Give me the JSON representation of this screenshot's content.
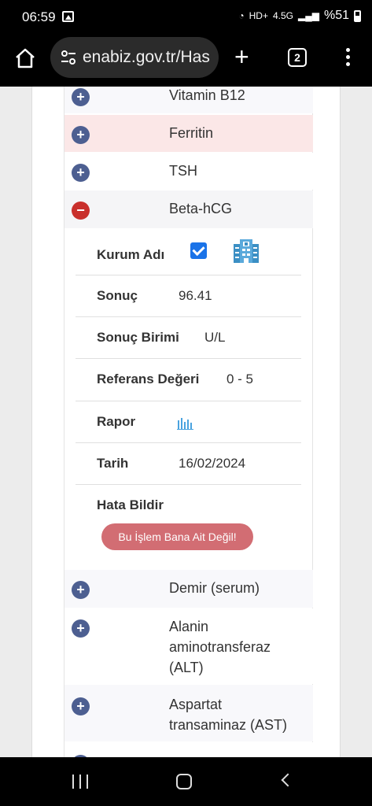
{
  "status_bar": {
    "time": "06:59",
    "network": "4.5G",
    "battery": "%51"
  },
  "browser": {
    "url": "enabiz.gov.tr/Has",
    "tab_count": "2"
  },
  "tests_above": [
    {
      "name": "Vitamin B12",
      "state": "collapsed"
    },
    {
      "name": "Ferritin",
      "state": "collapsed",
      "highlighted": true
    },
    {
      "name": "TSH",
      "state": "collapsed"
    }
  ],
  "expanded_test": {
    "name": "Beta-hCG",
    "state": "expanded",
    "fields": {
      "kurum_adi": {
        "label": "Kurum Adı",
        "checked": true
      },
      "sonuc": {
        "label": "Sonuç",
        "value": "96.41"
      },
      "sonuc_birimi": {
        "label": "Sonuç Birimi",
        "value": "U/L"
      },
      "referans_degeri": {
        "label": "Referans Değeri",
        "value": "0 - 5"
      },
      "rapor": {
        "label": "Rapor"
      },
      "tarih": {
        "label": "Tarih",
        "value": "16/02/2024"
      },
      "hata_bildir": {
        "label": "Hata Bildir",
        "button": "Bu İşlem Bana Ait Değil!"
      }
    }
  },
  "tests_below": [
    {
      "name": "Demir (serum)",
      "state": "collapsed"
    },
    {
      "name": "Alanin aminotransferaz (ALT)",
      "line1": "Alanin",
      "line2": "aminotransferaz",
      "line3": "(ALT)",
      "state": "collapsed"
    },
    {
      "name": "Aspartat transaminaz (AST)",
      "line1": "Aspartat",
      "line2": "transaminaz (AST)",
      "state": "collapsed"
    }
  ],
  "colors": {
    "toggle_plus": "#4d5f91",
    "toggle_minus": "#c9302c",
    "highlight_row": "#fbe7e7",
    "error_button": "#d26d73"
  }
}
